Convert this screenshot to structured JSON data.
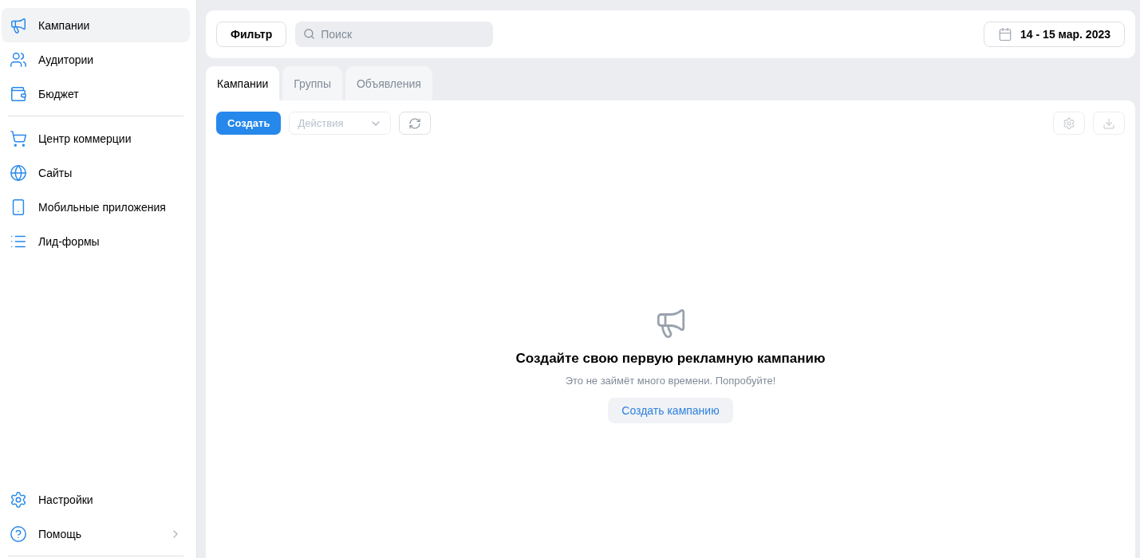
{
  "sidebar": {
    "groups": [
      [
        {
          "kind": "megaphone",
          "label": "Кампании",
          "selected": true
        },
        {
          "kind": "users",
          "label": "Аудитории",
          "selected": false
        },
        {
          "kind": "wallet",
          "label": "Бюджет",
          "selected": false
        }
      ],
      [
        {
          "kind": "cart",
          "label": "Центр коммерции",
          "selected": false
        },
        {
          "kind": "globe",
          "label": "Сайты",
          "selected": false
        },
        {
          "kind": "phone",
          "label": "Мобильные приложения",
          "selected": false
        },
        {
          "kind": "list",
          "label": "Лид-формы",
          "selected": false
        }
      ]
    ],
    "bottom": [
      {
        "kind": "settings",
        "label": "Настройки",
        "selected": false,
        "chevron": false
      },
      {
        "kind": "help",
        "label": "Помощь",
        "selected": false,
        "chevron": true
      }
    ]
  },
  "header": {
    "filter_button": "Фильтр",
    "search": {
      "placeholder": "Поиск"
    },
    "date_range": "14 - 15 мар. 2023"
  },
  "tabs": [
    {
      "label": "Кампании",
      "selected": true
    },
    {
      "label": "Группы",
      "selected": false
    },
    {
      "label": "Объявления",
      "selected": false
    }
  ],
  "toolbar": {
    "create_button": "Создать",
    "actions": {
      "placeholder": "Действия",
      "disabled": true
    }
  },
  "empty_state": {
    "title": "Создайте свою первую рекламную кампанию",
    "subtitle": "Это не займёт много времени. Попробуйте!",
    "button": "Создать кампанию"
  }
}
